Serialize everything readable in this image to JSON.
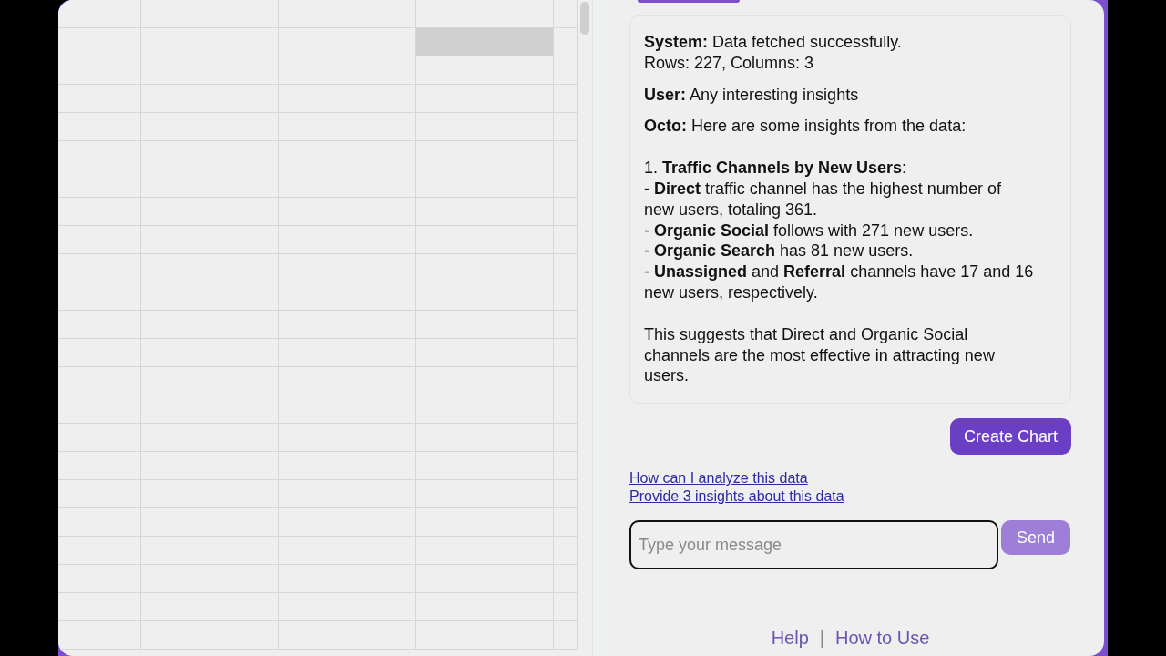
{
  "grid": {
    "rows": [
      {
        "cells": [
          {
            "selected": false
          },
          {
            "selected": false
          },
          {
            "selected": false
          },
          {
            "selected": false
          },
          {
            "selected": false
          }
        ]
      },
      {
        "cells": [
          {
            "selected": false
          },
          {
            "selected": false
          },
          {
            "selected": false
          },
          {
            "selected": true
          },
          {
            "selected": false
          }
        ]
      },
      {
        "cells": [
          {
            "selected": false
          },
          {
            "selected": false
          },
          {
            "selected": false
          },
          {
            "selected": false
          },
          {
            "selected": false
          }
        ]
      },
      {
        "cells": [
          {
            "selected": false
          },
          {
            "selected": false
          },
          {
            "selected": false
          },
          {
            "selected": false
          },
          {
            "selected": false
          }
        ]
      },
      {
        "cells": [
          {
            "selected": false
          },
          {
            "selected": false
          },
          {
            "selected": false
          },
          {
            "selected": false
          },
          {
            "selected": false
          }
        ]
      },
      {
        "cells": [
          {
            "selected": false
          },
          {
            "selected": false
          },
          {
            "selected": false
          },
          {
            "selected": false
          },
          {
            "selected": false
          }
        ]
      },
      {
        "cells": [
          {
            "selected": false
          },
          {
            "selected": false
          },
          {
            "selected": false
          },
          {
            "selected": false
          },
          {
            "selected": false
          }
        ]
      },
      {
        "cells": [
          {
            "selected": false
          },
          {
            "selected": false
          },
          {
            "selected": false
          },
          {
            "selected": false
          },
          {
            "selected": false
          }
        ]
      },
      {
        "cells": [
          {
            "selected": false
          },
          {
            "selected": false
          },
          {
            "selected": false
          },
          {
            "selected": false
          },
          {
            "selected": false
          }
        ]
      },
      {
        "cells": [
          {
            "selected": false
          },
          {
            "selected": false
          },
          {
            "selected": false
          },
          {
            "selected": false
          },
          {
            "selected": false
          }
        ]
      },
      {
        "cells": [
          {
            "selected": false
          },
          {
            "selected": false
          },
          {
            "selected": false
          },
          {
            "selected": false
          },
          {
            "selected": false
          }
        ]
      },
      {
        "cells": [
          {
            "selected": false
          },
          {
            "selected": false
          },
          {
            "selected": false
          },
          {
            "selected": false
          },
          {
            "selected": false
          }
        ]
      },
      {
        "cells": [
          {
            "selected": false
          },
          {
            "selected": false
          },
          {
            "selected": false
          },
          {
            "selected": false
          },
          {
            "selected": false
          }
        ]
      },
      {
        "cells": [
          {
            "selected": false
          },
          {
            "selected": false
          },
          {
            "selected": false
          },
          {
            "selected": false
          },
          {
            "selected": false
          }
        ]
      },
      {
        "cells": [
          {
            "selected": false
          },
          {
            "selected": false
          },
          {
            "selected": false
          },
          {
            "selected": false
          },
          {
            "selected": false
          }
        ]
      },
      {
        "cells": [
          {
            "selected": false
          },
          {
            "selected": false
          },
          {
            "selected": false
          },
          {
            "selected": false
          },
          {
            "selected": false
          }
        ]
      },
      {
        "cells": [
          {
            "selected": false
          },
          {
            "selected": false
          },
          {
            "selected": false
          },
          {
            "selected": false
          },
          {
            "selected": false
          }
        ]
      },
      {
        "cells": [
          {
            "selected": false
          },
          {
            "selected": false
          },
          {
            "selected": false
          },
          {
            "selected": false
          },
          {
            "selected": false
          }
        ]
      },
      {
        "cells": [
          {
            "selected": false
          },
          {
            "selected": false
          },
          {
            "selected": false
          },
          {
            "selected": false
          },
          {
            "selected": false
          }
        ]
      },
      {
        "cells": [
          {
            "selected": false
          },
          {
            "selected": false
          },
          {
            "selected": false
          },
          {
            "selected": false
          },
          {
            "selected": false
          }
        ]
      },
      {
        "cells": [
          {
            "selected": false
          },
          {
            "selected": false
          },
          {
            "selected": false
          },
          {
            "selected": false
          },
          {
            "selected": false
          }
        ]
      },
      {
        "cells": [
          {
            "selected": false
          },
          {
            "selected": false
          },
          {
            "selected": false
          },
          {
            "selected": false
          },
          {
            "selected": false
          }
        ]
      },
      {
        "cells": [
          {
            "selected": false
          },
          {
            "selected": false
          },
          {
            "selected": false
          },
          {
            "selected": false
          },
          {
            "selected": false
          }
        ]
      }
    ]
  },
  "chat": {
    "messages": [
      {
        "paragraphs": [
          "**System:** Data fetched successfully.\nRows: 227, Columns: 3"
        ]
      },
      {
        "paragraphs": [
          "**User:** Any interesting insights"
        ]
      },
      {
        "paragraphs": [
          "**Octo:** Here are some insights from the data:",
          "1. **Traffic Channels by New Users**:\n- **Direct** traffic channel has the highest number of new users, totaling 361.\n- **Organic Social** follows with 271 new users.\n- **Organic Search** has 81 new users.\n- **Unassigned** and **Referral** channels have 17 and 16 new users, respectively.",
          "This suggests that Direct and Organic Social channels are the most effective in attracting new users."
        ]
      }
    ],
    "action_button": "Create Chart",
    "suggestions": [
      "How can I analyze this data",
      "Provide 3 insights about this data"
    ],
    "input": {
      "placeholder": "Type your message"
    },
    "send_button": "Send"
  },
  "footer": {
    "links": [
      "Help",
      "How to Use"
    ],
    "separator": "|"
  }
}
